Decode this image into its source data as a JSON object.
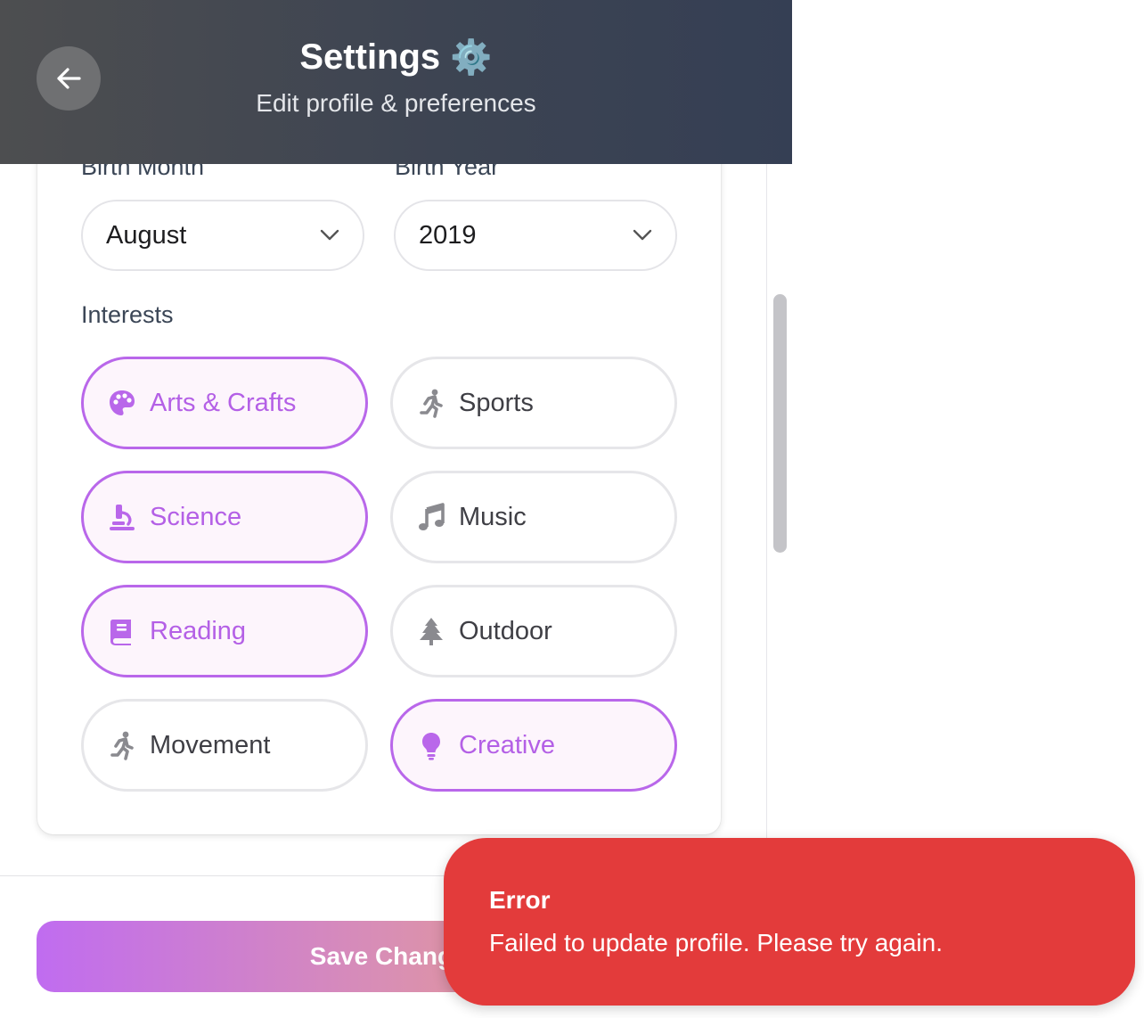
{
  "header": {
    "title": "Settings",
    "title_icon": "⚙️",
    "subtitle": "Edit profile & preferences",
    "back_icon": "arrow-left-icon"
  },
  "form": {
    "birth_month": {
      "label": "Birth Month",
      "value": "August"
    },
    "birth_year": {
      "label": "Birth Year",
      "value": "2019"
    },
    "interests_label": "Interests",
    "interests": [
      {
        "label": "Arts & Crafts",
        "icon": "palette-icon",
        "selected": true
      },
      {
        "label": "Sports",
        "icon": "running-person-icon",
        "selected": false
      },
      {
        "label": "Science",
        "icon": "microscope-icon",
        "selected": true
      },
      {
        "label": "Music",
        "icon": "music-note-icon",
        "selected": false
      },
      {
        "label": "Reading",
        "icon": "book-icon",
        "selected": true
      },
      {
        "label": "Outdoor",
        "icon": "tree-icon",
        "selected": false
      },
      {
        "label": "Movement",
        "icon": "running-person-icon",
        "selected": false
      },
      {
        "label": "Creative",
        "icon": "lightbulb-icon",
        "selected": true
      }
    ]
  },
  "footer": {
    "save_label": "Save Changes"
  },
  "toast": {
    "title": "Error",
    "message": "Failed to update profile. Please try again."
  },
  "colors": {
    "accent": "#b967ea",
    "error": "#e33b3b",
    "header_start": "#4d4e50",
    "header_end": "#353f54"
  }
}
